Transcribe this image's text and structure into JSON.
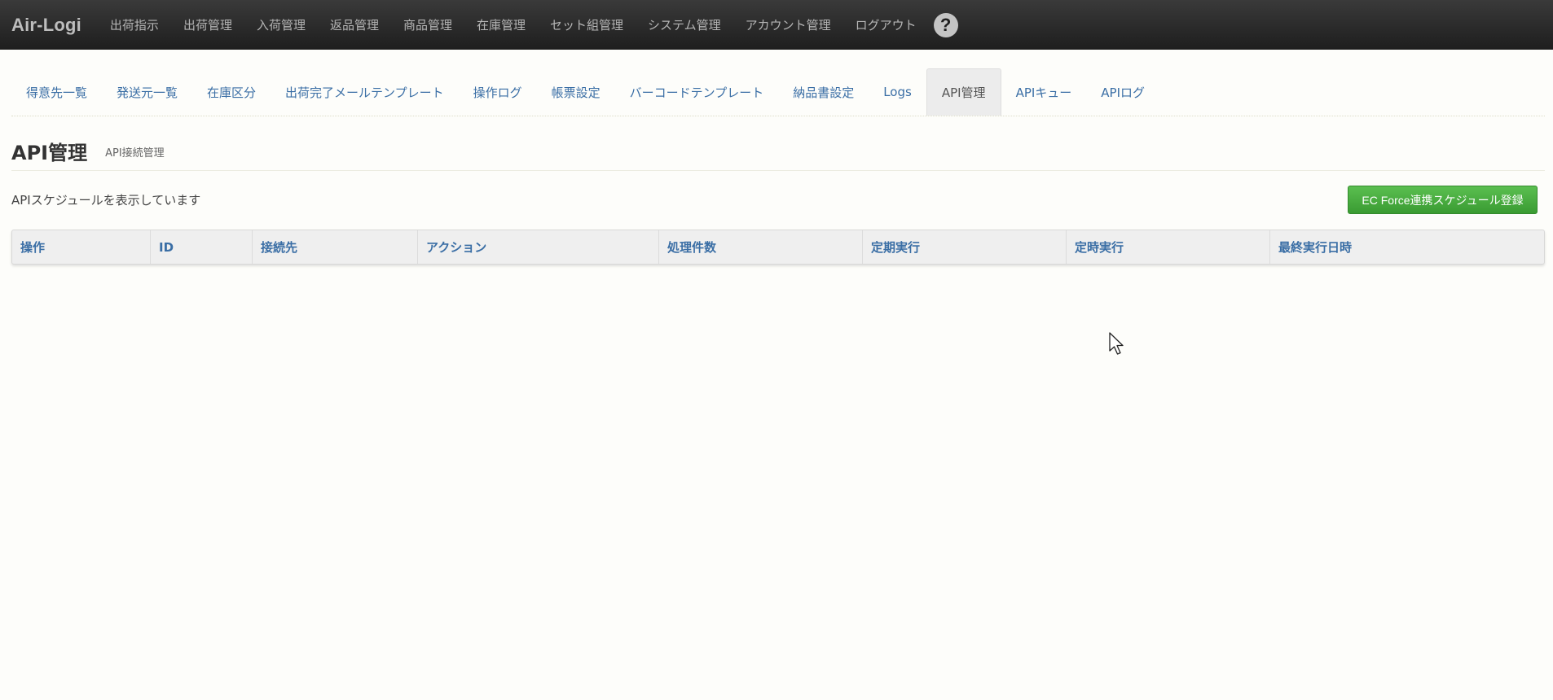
{
  "navbar": {
    "brand": "Air-Logi",
    "items": [
      "出荷指示",
      "出荷管理",
      "入荷管理",
      "返品管理",
      "商品管理",
      "在庫管理",
      "セット組管理",
      "システム管理",
      "アカウント管理",
      "ログアウト"
    ],
    "help_glyph": "?"
  },
  "tabs": {
    "items": [
      "得意先一覧",
      "発送元一覧",
      "在庫区分",
      "出荷完了メールテンプレート",
      "操作ログ",
      "帳票設定",
      "バーコードテンプレート",
      "納品書設定",
      "Logs",
      "API管理",
      "APIキュー",
      "APIログ"
    ],
    "active": "API管理"
  },
  "page": {
    "title": "API管理",
    "subtitle": "API接続管理",
    "info": "APIスケジュールを表示しています",
    "action_button": "EC Force連携スケジュール登録"
  },
  "table": {
    "headers": [
      "操作",
      "ID",
      "接続先",
      "アクション",
      "処理件数",
      "定期実行",
      "定時実行",
      "最終実行日時"
    ],
    "rows": []
  },
  "colors": {
    "navbar": "#2b2b2b",
    "link": "#3a6ea5",
    "primary_button": "#48ac3f",
    "background": "#fdfdfa"
  },
  "icons": {
    "help": "question-circle-icon",
    "cursor": "mouse-pointer-icon"
  }
}
